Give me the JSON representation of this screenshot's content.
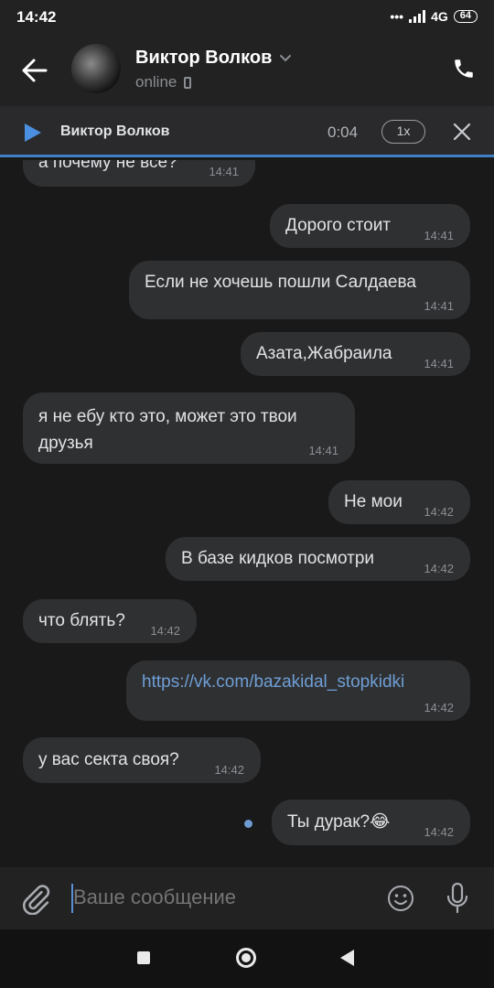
{
  "status_bar": {
    "time": "14:42",
    "network": "4G",
    "battery": "64"
  },
  "header": {
    "name": "Виктор Волков",
    "status": "online"
  },
  "player": {
    "title": "Виктор Волков",
    "time": "0:04",
    "speed": "1x"
  },
  "messages": [
    {
      "side": "in",
      "text": "а почему не все?",
      "time": "14:41"
    },
    {
      "side": "out",
      "text": "Дорого стоит",
      "time": "14:41"
    },
    {
      "side": "out",
      "text": "Если не хочешь пошли Салдаева",
      "time": "14:41"
    },
    {
      "side": "out",
      "text": "Азата,Жабраила",
      "time": "14:41"
    },
    {
      "side": "in",
      "text_line1": "я не ебу кто это, может это твои",
      "text_line2": "друзья",
      "time": "14:41"
    },
    {
      "side": "out",
      "text": "Не мои",
      "time": "14:42"
    },
    {
      "side": "out",
      "text": "В базе кидков посмотри",
      "time": "14:42"
    },
    {
      "side": "in",
      "text": "что блять?",
      "time": "14:42"
    },
    {
      "side": "out",
      "link": "https://vk.com/bazakidal_stopkidki",
      "time": "14:42"
    },
    {
      "side": "in",
      "text": "у вас секта своя?",
      "time": "14:42"
    },
    {
      "side": "out",
      "text": "Ты дурак?😂",
      "time": "14:42",
      "unread": true
    }
  ],
  "composer": {
    "placeholder": "Ваше сообщение"
  },
  "colors": {
    "accent": "#3f7fc6",
    "bubble": "#2f3032",
    "background": "#19191a",
    "link": "#6f9ed6"
  }
}
